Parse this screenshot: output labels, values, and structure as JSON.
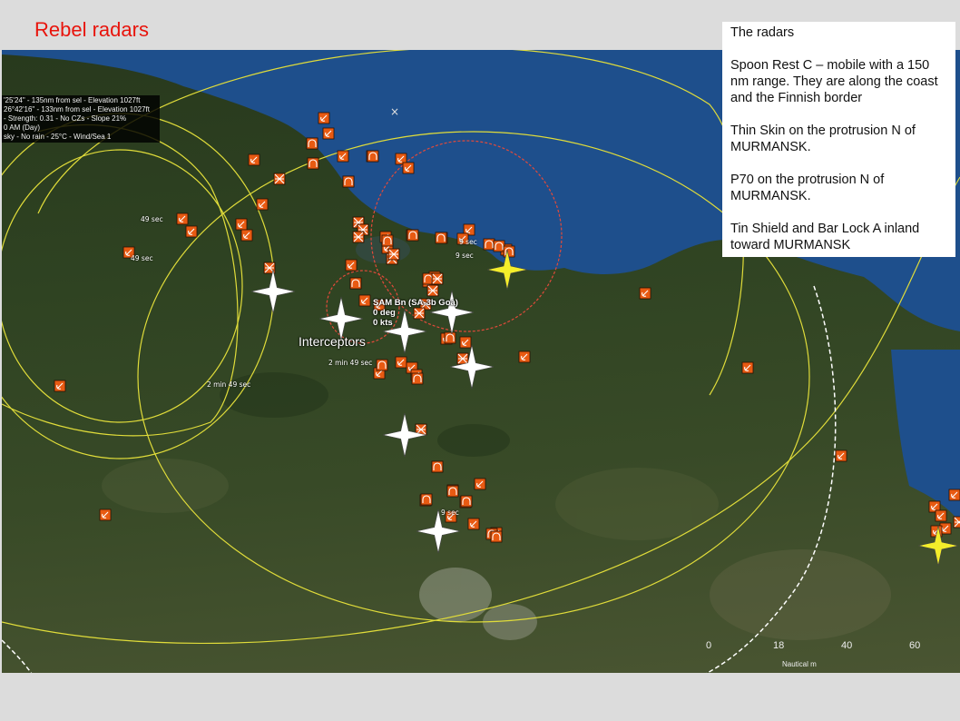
{
  "slide": {
    "title": "Rebel radars",
    "title_color": "#e8140c"
  },
  "hover_info": {
    "lines": [
      "'25'24\" - 135nm from sel - Elevation 1027ft",
      "26°42'16\" - 133nm from sel - Elevation 1027ft",
      "- Strength: 0.31 - No CZs - Slope 21%",
      "0 AM (Day)",
      "sky - No rain - 25°C - Wind/Sea 1"
    ]
  },
  "notes": {
    "heading": "The radars",
    "paragraphs": [
      "Spoon Rest C – mobile with a 150 nm range.  They are along the coast and the Finnish border",
      "Thin Skin on the protrusion N of MURMANSK.",
      "P70 on the protrusion N of MURMANSK.",
      "Tin Shield and Bar Lock A inland toward MURMANSK"
    ]
  },
  "map": {
    "interceptors_label": "Interceptors",
    "sam_unit": {
      "name": "SAM Bn (SA-3b Goa)",
      "heading": "0 deg",
      "speed": "0 kts"
    },
    "timers": [
      "49 sec",
      "49 sec",
      "2 min 49 sec",
      "2 min 49 sec",
      "9 sec",
      "9 sec",
      "9 sec"
    ],
    "scale": {
      "ticks": [
        "0",
        "18",
        "40",
        "60"
      ],
      "unit_label": "Nautical m"
    },
    "colors": {
      "sea": "#1e4f8c",
      "unit_fill": "#e85a12",
      "range_ring": "#e0dc3a",
      "selected_ring": "#e24a3a",
      "aircraft": "#ffffff",
      "highlight_aircraft": "#f4ee2a"
    },
    "icons": [
      "radar-unit-icon",
      "sam-site-icon",
      "facility-icon",
      "aircraft-icon"
    ]
  }
}
